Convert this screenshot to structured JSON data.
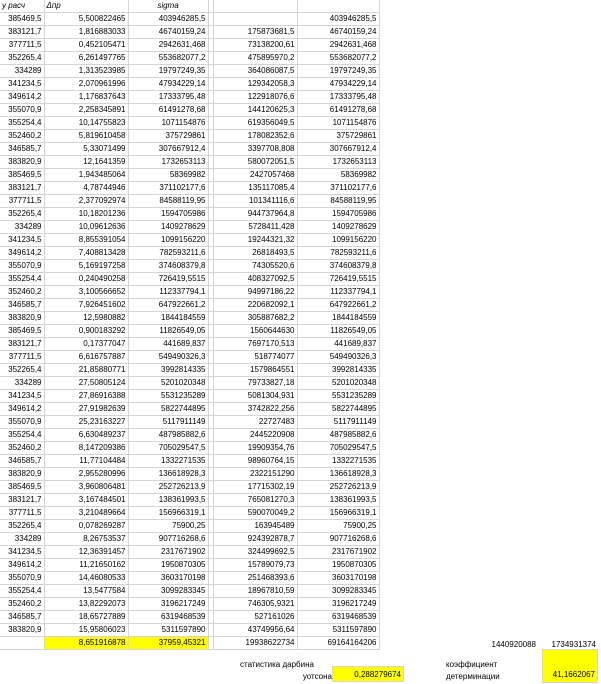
{
  "header": {
    "col0": "y расч",
    "col1": "Δпр",
    "col2": "sigma"
  },
  "rows": [
    [
      "385469,5",
      "5,500822465",
      "403946285,5",
      "",
      "403946285,5"
    ],
    [
      "383121,7",
      "1,816883033",
      "46740159,24",
      "175873681,5",
      "46740159,24"
    ],
    [
      "377711,5",
      "0,452105471",
      "2942631,468",
      "73138200,61",
      "2942631,468"
    ],
    [
      "352265,4",
      "6,261497765",
      "553682077,2",
      "475895970,2",
      "553682077,2"
    ],
    [
      "334289",
      "1,313523985",
      "19797249,35",
      "364086087,5",
      "19797249,35"
    ],
    [
      "341234,5",
      "2,070961996",
      "47934229,14",
      "129342058,3",
      "47934229,14"
    ],
    [
      "349614,2",
      "1,176837643",
      "17333795,48",
      "122918076,6",
      "17333795,48"
    ],
    [
      "355070,9",
      "2,258345891",
      "61491278,68",
      "144120625,3",
      "61491278,68"
    ],
    [
      "355254,4",
      "10,14755823",
      "1071154876",
      "619356049,5",
      "1071154876"
    ],
    [
      "352460,2",
      "5,819610458",
      "375729861",
      "178082352,6",
      "375729861"
    ],
    [
      "346585,7",
      "5,33071499",
      "307667912,4",
      "3397708,808",
      "307667912,4"
    ],
    [
      "383820,9",
      "12,1641359",
      "1732653113",
      "580072051,5",
      "1732653113"
    ],
    [
      "385469,5",
      "1,943485064",
      "58369982",
      "2427057468",
      "58369982"
    ],
    [
      "383121,7",
      "4,78744946",
      "371102177,6",
      "135117085,4",
      "371102177,6"
    ],
    [
      "377711,5",
      "2,377092974",
      "84588119,95",
      "101341116,6",
      "84588119,95"
    ],
    [
      "352265,4",
      "10,18201236",
      "1594705986",
      "944737964,8",
      "1594705986"
    ],
    [
      "334289",
      "10,09612636",
      "1409278629",
      "5728411,428",
      "1409278629"
    ],
    [
      "341234,5",
      "8,855391054",
      "1099156220",
      "19244321,32",
      "1099156220"
    ],
    [
      "349614,2",
      "7,408813428",
      "782593211,6",
      "26818493,5",
      "782593211,6"
    ],
    [
      "355070,9",
      "5,169197258",
      "374608379,8",
      "74305520,6",
      "374608379,8"
    ],
    [
      "355254,4",
      "0,240490258",
      "726419,5515",
      "408327092,5",
      "726419,5515"
    ],
    [
      "352460,2",
      "3,100566652",
      "112337794,1",
      "94997186,22",
      "112337794,1"
    ],
    [
      "346585,7",
      "7,926451602",
      "647922661,2",
      "220682092,1",
      "647922661,2"
    ],
    [
      "383820,9",
      "12,5980882",
      "1844184559",
      "305887682,2",
      "1844184559"
    ],
    [
      "385469,5",
      "0,900183292",
      "11826549,05",
      "1560644630",
      "11826549,05"
    ],
    [
      "383121,7",
      "0,17377047",
      "441689,837",
      "7697170,513",
      "441689,837"
    ],
    [
      "377711,5",
      "6,616757887",
      "549490326,3",
      "518774077",
      "549490326,3"
    ],
    [
      "352265,4",
      "21,85880771",
      "3992814335",
      "1579864551",
      "3992814335"
    ],
    [
      "334289",
      "27,50805124",
      "5201020348",
      "79733827,18",
      "5201020348"
    ],
    [
      "341234,5",
      "27,86916388",
      "5531235289",
      "5081304,931",
      "5531235289"
    ],
    [
      "349614,2",
      "27,91982639",
      "5822744895",
      "3742822,256",
      "5822744895"
    ],
    [
      "355070,9",
      "25,23163227",
      "5117911149",
      "22727483",
      "5117911149"
    ],
    [
      "355254,4",
      "6,630489237",
      "487985882,6",
      "2445220908",
      "487985882,6"
    ],
    [
      "352460,2",
      "8,147209386",
      "705029547,5",
      "19909354,76",
      "705029547,5"
    ],
    [
      "346585,7",
      "11,77104484",
      "1332271535",
      "98960764,15",
      "1332271535"
    ],
    [
      "383820,9",
      "2,955280996",
      "136618928,3",
      "2322151290",
      "136618928,3"
    ],
    [
      "385469,5",
      "3,960806481",
      "252726213,9",
      "17715302,19",
      "252726213,9"
    ],
    [
      "383121,7",
      "3,167484501",
      "138361993,5",
      "765081270,3",
      "138361993,5"
    ],
    [
      "377711,5",
      "3,210489664",
      "156966319,1",
      "590070049,2",
      "156966319,1"
    ],
    [
      "352265,4",
      "0,078269287",
      "75900,25",
      "163945489",
      "75900,25"
    ],
    [
      "334289",
      "8,26753537",
      "907716268,6",
      "924392878,7",
      "907716268,6"
    ],
    [
      "341234,5",
      "12,36391457",
      "2317671902",
      "324499692,5",
      "2317671902"
    ],
    [
      "349614,2",
      "11,21650162",
      "1950870305",
      "15789079,73",
      "1950870305"
    ],
    [
      "355070,9",
      "14,46080533",
      "3603170198",
      "251468393,6",
      "3603170198"
    ],
    [
      "355254,4",
      "13,5477584",
      "3099283345",
      "18967810,59",
      "3099283345"
    ],
    [
      "352460,2",
      "13,82292073",
      "3196217249",
      "746305,9321",
      "3196217249"
    ],
    [
      "346585,7",
      "18,65727889",
      "6319468539",
      "527161026",
      "6319468539"
    ],
    [
      "383820,9",
      "15,95806023",
      "5311597890",
      "43749956,64",
      "5311597890"
    ]
  ],
  "totals": {
    "col1": "8,651916878",
    "col2": "37959,45321",
    "col4": "19938622734",
    "col5": "69164164206"
  },
  "right": {
    "val1": "1440920088",
    "val2": "1734931374"
  },
  "durbin": {
    "label1": "статистика дарбина",
    "label2": "уотсона",
    "value": "0,288279674"
  },
  "determ": {
    "label1": "коэффициент",
    "label2": "детерминации",
    "value": "41,1662067"
  }
}
